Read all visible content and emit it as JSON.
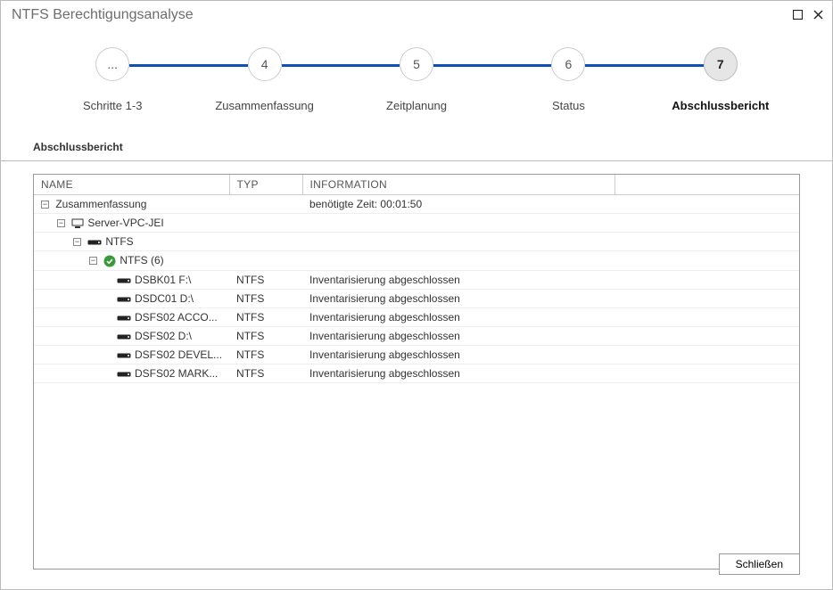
{
  "window": {
    "title": "NTFS Berechtigungsanalyse"
  },
  "stepper": {
    "steps": [
      {
        "num": "...",
        "label": "Schritte 1-3"
      },
      {
        "num": "4",
        "label": "Zusammenfassung"
      },
      {
        "num": "5",
        "label": "Zeitplanung"
      },
      {
        "num": "6",
        "label": "Status"
      },
      {
        "num": "7",
        "label": "Abschlussbericht"
      }
    ],
    "activeIndex": 4
  },
  "section_title": "Abschlussbericht",
  "columns": {
    "name": "NAME",
    "type": "TYP",
    "info": "INFORMATION"
  },
  "summary_row": {
    "name": "Zusammenfassung",
    "info": "benötigte Zeit: 00:01:50"
  },
  "server_row": {
    "name": "Server-VPC-JEI"
  },
  "ntfs_row": {
    "name": "NTFS"
  },
  "ntfs_group": {
    "name": "NTFS (6)"
  },
  "drives": [
    {
      "name": "DSBK01 F:\\",
      "type": "NTFS",
      "info": "Inventarisierung abgeschlossen"
    },
    {
      "name": "DSDC01 D:\\",
      "type": "NTFS",
      "info": "Inventarisierung abgeschlossen"
    },
    {
      "name": "DSFS02 ACCO...",
      "type": "NTFS",
      "info": "Inventarisierung abgeschlossen"
    },
    {
      "name": "DSFS02 D:\\",
      "type": "NTFS",
      "info": "Inventarisierung abgeschlossen"
    },
    {
      "name": "DSFS02 DEVEL...",
      "type": "NTFS",
      "info": "Inventarisierung abgeschlossen"
    },
    {
      "name": "DSFS02 MARK...",
      "type": "NTFS",
      "info": "Inventarisierung abgeschlossen"
    }
  ],
  "buttons": {
    "close": "Schließen"
  }
}
